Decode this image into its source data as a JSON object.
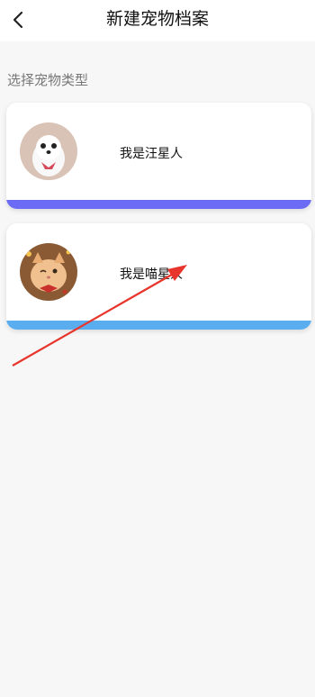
{
  "header": {
    "title": "新建宠物档案",
    "back_icon": "chevron-left-icon"
  },
  "section": {
    "label": "选择宠物类型"
  },
  "pets": [
    {
      "label": "我是汪星人",
      "avatar": "dog-avatar",
      "bar_color": "#6b6bf5"
    },
    {
      "label": "我是喵星人",
      "avatar": "cat-avatar",
      "bar_color": "#5aaef0"
    }
  ],
  "colors": {
    "background": "#f7f7f7",
    "annotation_arrow": "#e8352b"
  }
}
